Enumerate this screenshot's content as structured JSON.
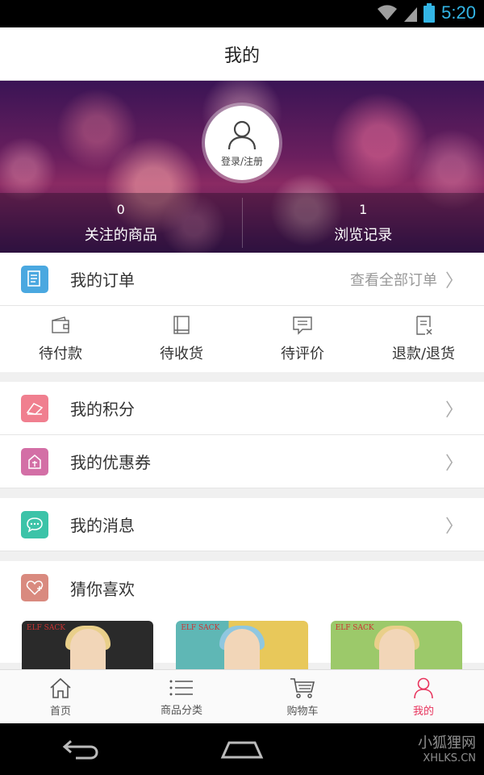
{
  "status_bar": {
    "time": "5:20",
    "icons": [
      "wifi-icon",
      "signal-icon",
      "battery-icon"
    ]
  },
  "header": {
    "title": "我的"
  },
  "profile": {
    "login_label": "登录/注册",
    "stats": [
      {
        "count": "0",
        "label": "关注的商品"
      },
      {
        "count": "1",
        "label": "浏览记录"
      }
    ]
  },
  "orders": {
    "label": "我的订单",
    "view_all": "查看全部订单",
    "statuses": [
      {
        "label": "待付款",
        "icon": "wallet-icon"
      },
      {
        "label": "待收货",
        "icon": "book-icon"
      },
      {
        "label": "待评价",
        "icon": "comment-icon"
      },
      {
        "label": "退款/退货",
        "icon": "refund-doc-icon"
      }
    ]
  },
  "menu": {
    "points": "我的积分",
    "coupons": "我的优惠券",
    "messages": "我的消息",
    "recommend": "猜你喜欢"
  },
  "products": [
    {
      "brand": "ELF SACK",
      "bg": "#2a2a2a"
    },
    {
      "brand": "ELF SACK",
      "bg": "#e8c85a"
    },
    {
      "brand": "ELF SACK",
      "bg": "#9cc96a"
    }
  ],
  "tabs": [
    {
      "label": "首页",
      "icon": "home-icon"
    },
    {
      "label": "商品分类",
      "icon": "list-icon"
    },
    {
      "label": "购物车",
      "icon": "cart-icon"
    },
    {
      "label": "我的",
      "icon": "person-icon"
    }
  ],
  "watermark": {
    "name": "小狐狸网",
    "url": "XHLKS.CN"
  },
  "colors": {
    "accent": "#e8335c",
    "status_blue": "#33b5e5",
    "orders_icon": "#4aa8e0",
    "points_icon": "#f07f8f",
    "coupons_icon": "#d36fa6",
    "messages_icon": "#3cc3a8",
    "recommend_icon": "#d98a7f"
  }
}
